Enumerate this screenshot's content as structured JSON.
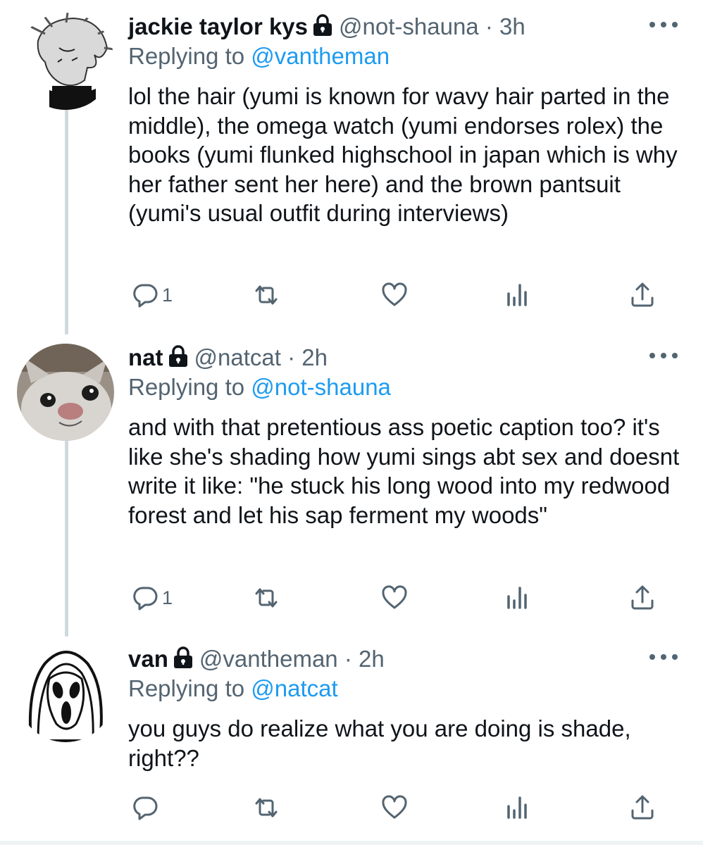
{
  "tweets": [
    {
      "name": "jackie taylor kys",
      "handle": "@not-shauna",
      "separator": "·",
      "time": "3h",
      "replying_prefix": "Replying to ",
      "replying_to": "@vantheman",
      "text": "lol the hair (yumi is known for wavy hair parted in the middle), the omega watch (yumi endorses rolex) the books (yumi flunked highschool in japan which is why her father sent her here) and the brown pantsuit (yumi's usual outfit during interviews)",
      "reply_count": "1",
      "avatar_icon": "manga-character-avatar"
    },
    {
      "name": "nat",
      "handle": "@natcat",
      "separator": "·",
      "time": "2h",
      "replying_prefix": "Replying to ",
      "replying_to": "@not-shauna",
      "text": "and with that pretentious ass poetic caption too? it's like she's shading how yumi sings abt sex and doesnt write it like: \"he stuck his long wood into my redwood forest and let his sap ferment my woods\"",
      "reply_count": "1",
      "avatar_icon": "cat-photo-avatar"
    },
    {
      "name": "van",
      "handle": "@vantheman",
      "separator": "·",
      "time": "2h",
      "replying_prefix": "Replying to ",
      "replying_to": "@natcat",
      "text": "you guys do realize what you are doing is shade, right??",
      "reply_count": "",
      "avatar_icon": "ghostface-avatar"
    }
  ],
  "icons": {
    "lock": "lock-icon",
    "more": "more-icon",
    "reply": "reply-icon",
    "retweet": "retweet-icon",
    "like": "like-icon",
    "analytics": "analytics-icon",
    "share": "share-icon"
  },
  "colors": {
    "link": "#1d9bf0",
    "secondary": "#536471",
    "text": "#0f1419",
    "thread_line": "#cfd9de"
  }
}
